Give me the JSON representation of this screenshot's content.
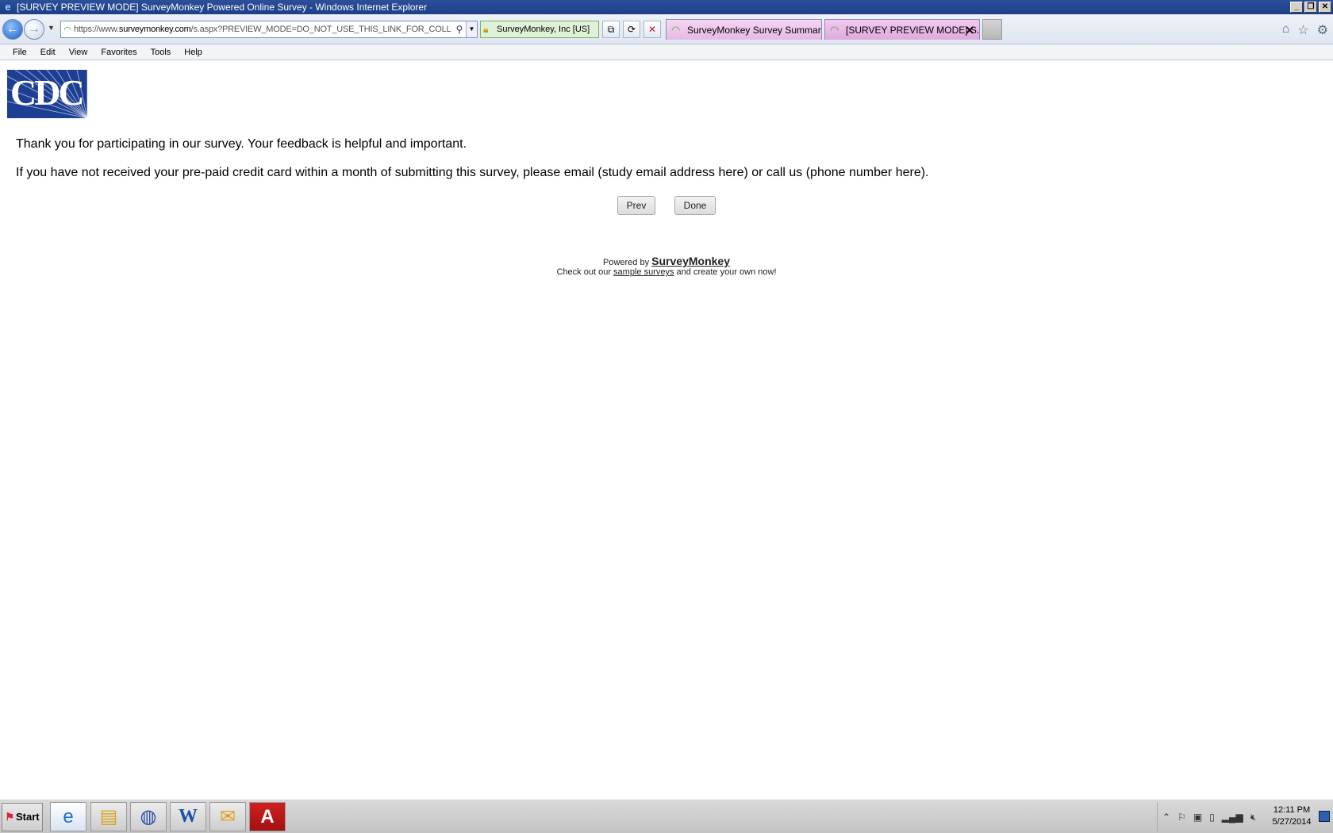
{
  "window": {
    "title": "[SURVEY PREVIEW MODE] SurveyMonkey Powered Online Survey - Windows Internet Explorer",
    "controls": {
      "minimize": "_",
      "restore": "❐",
      "close": "✕"
    }
  },
  "navbar": {
    "url_prefix": "https://www.",
    "url_host": "surveymonkey.com",
    "url_path": "/s.aspx?PREVIEW_MODE=DO_NOT_USE_THIS_LINK_FOR_COLL",
    "security_label": "SurveyMonkey, Inc [US]",
    "tabs": [
      {
        "label": "SurveyMonkey Survey Summar..."
      },
      {
        "label": "[SURVEY PREVIEW MODE] S..."
      }
    ],
    "tab_close": "✕"
  },
  "menu": {
    "items": [
      "File",
      "Edit",
      "View",
      "Favorites",
      "Tools",
      "Help"
    ]
  },
  "page": {
    "logo_text": "CDC",
    "message1": "Thank you for participating in our survey. Your feedback is helpful and important.",
    "message2": "If you have not received your pre-paid credit card within a month of submitting this survey, please email (study email address here) or call us (phone number here).",
    "prev_label": "Prev",
    "done_label": "Done",
    "powered_by": "Powered by",
    "brand": "SurveyMonkey",
    "checkout_prefix": "Check out our",
    "checkout_link": "sample surveys",
    "checkout_suffix": "and create your own now!"
  },
  "taskbar": {
    "start_label": "Start",
    "time": "12:11 PM",
    "date": "5/27/2014"
  },
  "colors": {
    "titlebar": "#1d3f86",
    "logo_bg": "#1c3f94",
    "tab_bg": "#e6b9e6",
    "security_bg": "#dff2d8"
  }
}
